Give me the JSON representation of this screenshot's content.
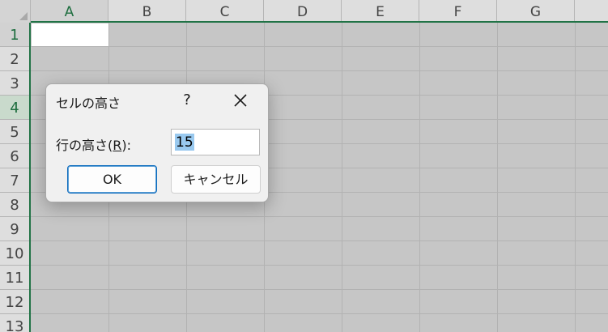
{
  "spreadsheet": {
    "columns": [
      "A",
      "B",
      "C",
      "D",
      "E",
      "F",
      "G"
    ],
    "rows": [
      "1",
      "2",
      "3",
      "4",
      "5",
      "6",
      "7",
      "8",
      "9",
      "10",
      "11",
      "12",
      "13"
    ],
    "active_cell": "A1",
    "selected_row": "4",
    "accent_color": "#217346"
  },
  "dialog": {
    "title": "セルの高さ",
    "help_label": "?",
    "close_icon": "close-icon",
    "field_label_prefix": "行の高さ(",
    "field_label_access_key": "R",
    "field_label_suffix": "):",
    "field_value": "15",
    "ok_label": "OK",
    "cancel_label": "キャンセル"
  }
}
